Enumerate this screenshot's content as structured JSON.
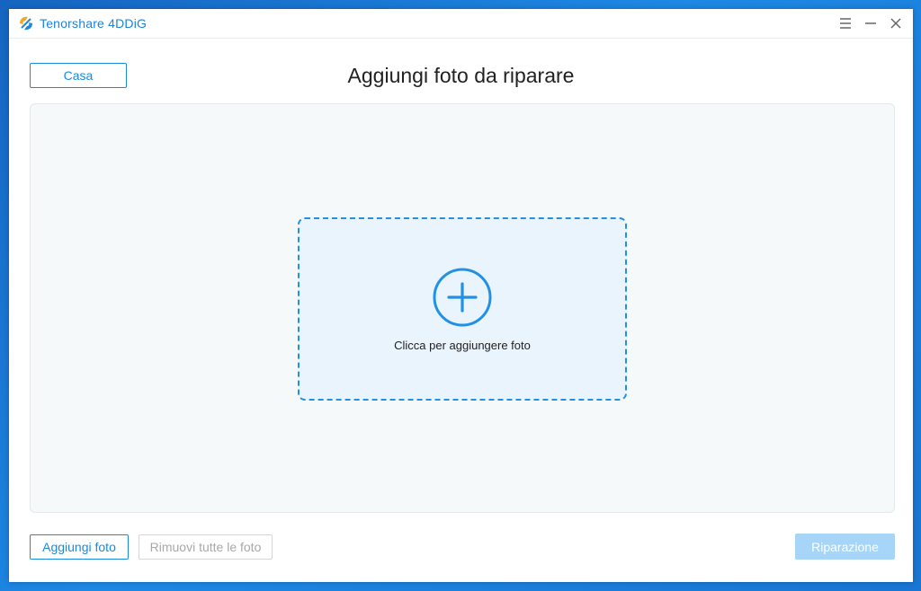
{
  "window": {
    "app_title": "Tenorshare 4DDiG",
    "controls": {
      "menu_icon": "menu-icon",
      "minimize_icon": "minimize-icon",
      "close_icon": "close-icon"
    }
  },
  "header": {
    "home_button": "Casa",
    "page_title": "Aggiungi foto da riparare"
  },
  "dropzone": {
    "icon": "plus-circle-icon",
    "label": "Clicca per aggiungere foto"
  },
  "footer": {
    "add_button": "Aggiungi foto",
    "remove_all_button": "Rimuovi tutte le foto",
    "repair_button": "Riparazione"
  },
  "colors": {
    "accent": "#1a8ae0",
    "dropzone_bg": "#eaf4fc",
    "repair_disabled": "#a6d5f8"
  }
}
